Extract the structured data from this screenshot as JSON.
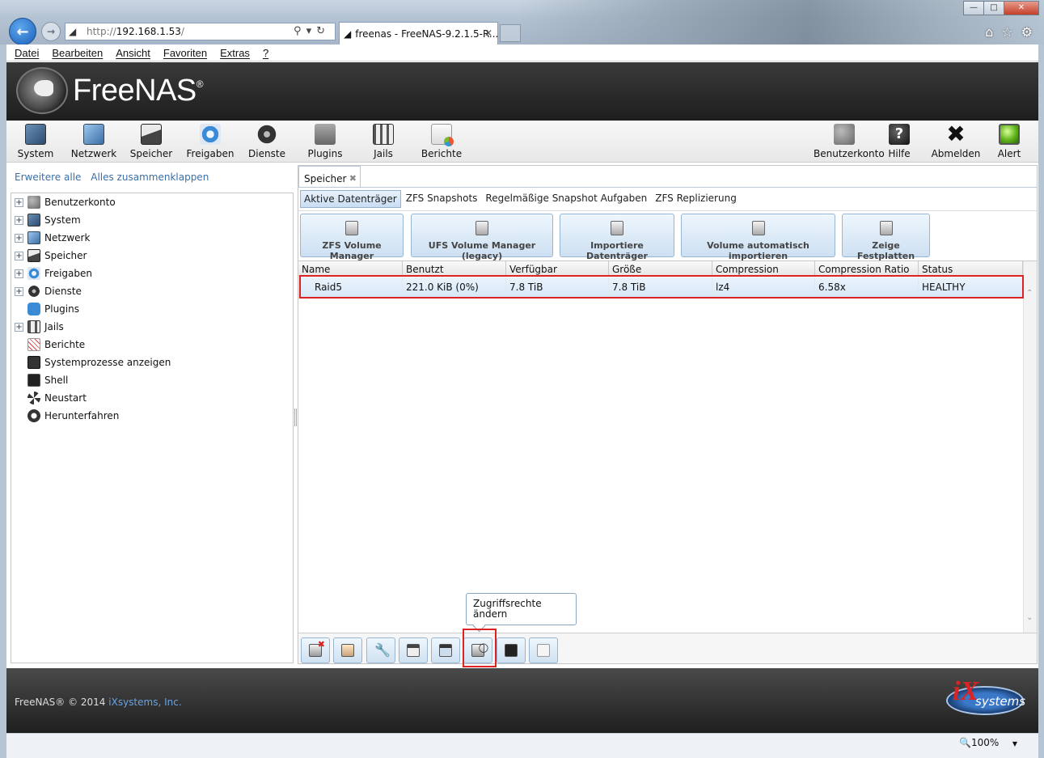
{
  "browser": {
    "url_host": "http://",
    "url_ip": "192.168.1.53",
    "url_rest": "/",
    "tab_title": "freenas - FreeNAS-9.2.1.5-R...",
    "menu": [
      "Datei",
      "Bearbeiten",
      "Ansicht",
      "Favoriten",
      "Extras",
      "?"
    ],
    "zoom": "100%"
  },
  "app": {
    "brand": "FreeNAS",
    "toolbar_left": [
      {
        "label": "System",
        "icon": "system-icon"
      },
      {
        "label": "Netzwerk",
        "icon": "network-icon"
      },
      {
        "label": "Speicher",
        "icon": "storage-icon"
      },
      {
        "label": "Freigaben",
        "icon": "shares-icon"
      },
      {
        "label": "Dienste",
        "icon": "services-icon"
      },
      {
        "label": "Plugins",
        "icon": "plugins-icon"
      },
      {
        "label": "Jails",
        "icon": "jails-icon"
      },
      {
        "label": "Berichte",
        "icon": "reports-icon"
      }
    ],
    "toolbar_right": [
      {
        "label": "Benutzerkonto",
        "icon": "account-icon"
      },
      {
        "label": "Hilfe",
        "icon": "help-icon"
      },
      {
        "label": "Abmelden",
        "icon": "logout-icon"
      },
      {
        "label": "Alert",
        "icon": "alert-icon"
      }
    ]
  },
  "sidebar": {
    "expand_all": "Erweitere alle",
    "collapse_all": "Alles zusammenklappen",
    "items": [
      {
        "label": "Benutzerkonto",
        "expandable": true
      },
      {
        "label": "System",
        "expandable": true
      },
      {
        "label": "Netzwerk",
        "expandable": true
      },
      {
        "label": "Speicher",
        "expandable": true
      },
      {
        "label": "Freigaben",
        "expandable": true
      },
      {
        "label": "Dienste",
        "expandable": true
      },
      {
        "label": "Plugins",
        "expandable": false
      },
      {
        "label": "Jails",
        "expandable": true
      },
      {
        "label": "Berichte",
        "expandable": false
      },
      {
        "label": "Systemprozesse anzeigen",
        "expandable": false
      },
      {
        "label": "Shell",
        "expandable": false
      },
      {
        "label": "Neustart",
        "expandable": false
      },
      {
        "label": "Herunterfahren",
        "expandable": false
      }
    ]
  },
  "main": {
    "panel_tab": "Speicher",
    "subtabs": [
      "Aktive Datenträger",
      "ZFS Snapshots",
      "Regelmäßige Snapshot Aufgaben",
      "ZFS Replizierung"
    ],
    "actions": [
      "ZFS Volume Manager",
      "UFS Volume Manager (legacy)",
      "Importiere Datenträger",
      "Volume automatisch importieren",
      "Zeige Festplatten"
    ],
    "table": {
      "columns": [
        "Name",
        "Benutzt",
        "Verfügbar",
        "Größe",
        "Compression",
        "Compression Ratio",
        "Status"
      ],
      "rows": [
        [
          "Raid5",
          "221.0 KiB (0%)",
          "7.8 TiB",
          "7.8 TiB",
          "lz4",
          "6.58x",
          "HEALTHY"
        ]
      ]
    },
    "tooltip": "Zugriffsrechte ändern"
  },
  "footer": {
    "copyright": "FreeNAS® © 2014",
    "company": "iXsystems, Inc.",
    "logo_text": "systems"
  }
}
